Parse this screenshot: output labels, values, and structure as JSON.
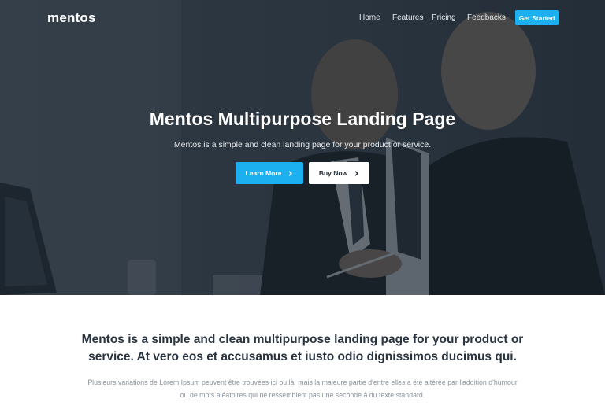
{
  "brand": {
    "logo_text": "mentos"
  },
  "nav": {
    "links": [
      "Home",
      "Features",
      "Pricing",
      "Feedbacks"
    ],
    "cta_label": "Get Started"
  },
  "hero": {
    "title": "Mentos Multipurpose Landing Page",
    "subtitle": "Mentos is a simple and clean landing page for your product or service.",
    "primary_button": "Learn More",
    "secondary_button": "Buy Now",
    "icons": {
      "button_icon": "chevron-right-icon"
    }
  },
  "intro": {
    "heading": "Mentos is a simple and clean multipurpose landing page for your product or service. At vero eos et accusamus et iusto odio dignissimos ducimus qui.",
    "body": "Plusieurs variations de Lorem Ipsum peuvent être trouvées ici ou là, mais la majeure partie d'entre elles a été altérée par l'addition d'humour ou de mots aléatoires qui ne ressemblent pas une seconde à du texte standard."
  },
  "colors": {
    "accent": "#1cb0f0",
    "hero_overlay": "#121b24",
    "heading_text": "#2a3440",
    "body_text": "#8a929a"
  }
}
